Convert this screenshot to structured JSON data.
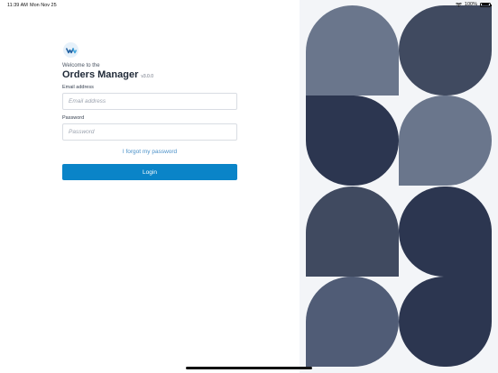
{
  "status_bar": {
    "time": "11:39 AM",
    "date": "Mon Nov 25",
    "battery_text": "100%",
    "battery_level": 1.0,
    "icons": [
      "wifi-icon",
      "battery-icon"
    ]
  },
  "login": {
    "logo_icon": "app-logo-icon",
    "welcome": "Welcome to the",
    "app_title": "Orders Manager",
    "version": "v3.0.0",
    "email_label": "Email address",
    "email_placeholder": "Email address",
    "email_value": "",
    "password_label": "Password",
    "password_placeholder": "Password",
    "password_value": "",
    "forgot_link": "I forgot my password",
    "login_button": "Login",
    "accent_color": "#0a84c8",
    "link_color": "#4a90c8"
  },
  "decor": {
    "colors": [
      "#6a768c",
      "#404a60",
      "#2c3650",
      "#505c76"
    ]
  }
}
